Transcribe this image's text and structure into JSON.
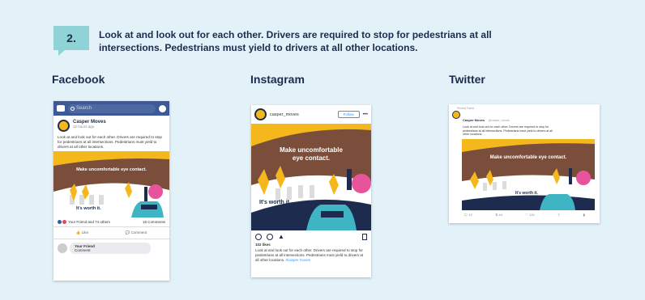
{
  "step": {
    "number": "2.",
    "text": "Look at and look out for each other. Drivers are required to stop for pedestrians at all intersections. Pedestrians must yield to drivers at all other locations."
  },
  "platforms": {
    "facebook": "Facebook",
    "instagram": "Instagram",
    "twitter": "Twitter"
  },
  "facebook": {
    "search_placeholder": "Search",
    "page_name": "Casper Moves",
    "timestamp": "12 hours ago",
    "caption": "Look at and look out for each other. Drivers are required to stop for pedestrians at all intersections. Pedestrians must yield to drivers at all other locations.",
    "artwork_headline": "Make uncomfortable eye contact.",
    "artwork_tagline": "It's worth it.",
    "reactions": "Your Friend and 74 others",
    "comments": "15 Comments",
    "like_label": "Like",
    "comment_label": "Comment",
    "comment_author": "Your Friend",
    "comment_text": "Comment"
  },
  "instagram": {
    "username": "casper_moves",
    "follow_label": "Follow",
    "more": "•••",
    "artwork_headline": "Make uncomfortable eye contact.",
    "artwork_tagline": "It's worth it.",
    "likes": "102 likes",
    "caption": "Look at and look out for each other. Drivers are required to stop for pedestrians at all intersections. Pedestrians must yield to drivers at all other locations.",
    "hashtag": "#casper moves"
  },
  "twitter": {
    "pinned": "Pinned Tweet",
    "name": "Casper Moves",
    "handle": "@casper_moves",
    "caption": "Look at and look out for each other. Drivers are required to stop for pedestrians at all intersections. Pedestrians must yield to drivers at all other locations.",
    "artwork_headline": "Make uncomfortable eye contact.",
    "artwork_tagline": "It's worth it.",
    "replies": "12",
    "retweets": "44",
    "likes": "124"
  },
  "colors": {
    "navy": "#1d2b4e",
    "teal": "#8fd3d6",
    "brown": "#7a4e3a",
    "yellow": "#f5b81c",
    "pink": "#e8549b",
    "facebook_blue": "#3b5998",
    "background": "#e3f2f8"
  }
}
